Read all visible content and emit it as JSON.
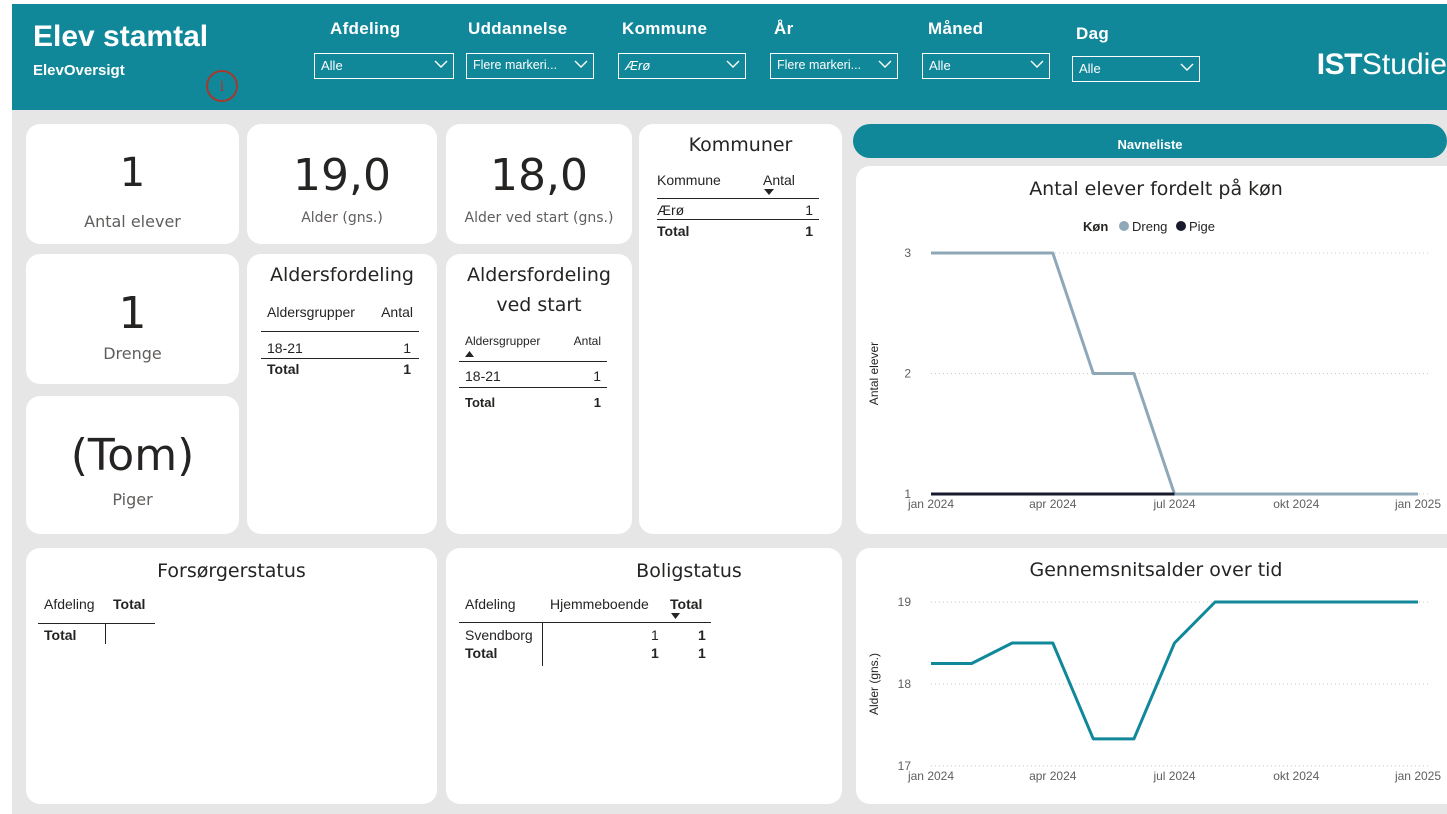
{
  "header": {
    "title": "Elev stamtal",
    "subtitle": "ElevOversigt",
    "logo_bold": "IST",
    "logo_text": "Studie",
    "brand_color": "#118899"
  },
  "slicers": [
    {
      "label": "Afdeling",
      "value": "Alle"
    },
    {
      "label": "Uddannelse",
      "value": "Flere markeri..."
    },
    {
      "label": "Kommune",
      "value": "Ærø"
    },
    {
      "label": "År",
      "value": "Flere markeri..."
    },
    {
      "label": "Måned",
      "value": "Alle"
    },
    {
      "label": "Dag",
      "value": "Alle"
    }
  ],
  "kpis": {
    "antal_elever": {
      "value": "1",
      "label": "Antal elever"
    },
    "alder": {
      "value": "19,0",
      "label": "Alder (gns.)"
    },
    "alder_start": {
      "value": "18,0",
      "label": "Alder ved start (gns.)"
    },
    "drenge": {
      "value": "1",
      "label": "Drenge"
    },
    "piger": {
      "value": "(Tom)",
      "label": "Piger"
    }
  },
  "kommuner": {
    "title": "Kommuner",
    "headers": [
      "Kommune",
      "Antal"
    ],
    "rows": [
      [
        "Ærø",
        "1"
      ]
    ],
    "total": [
      "Total",
      "1"
    ]
  },
  "aldersfordeling": {
    "title": "Aldersfordeling",
    "headers": [
      "Aldersgrupper",
      "Antal"
    ],
    "rows": [
      [
        "18-21",
        "1"
      ]
    ],
    "total": [
      "Total",
      "1"
    ]
  },
  "aldersfordeling_start": {
    "title_line1": "Aldersfordeling",
    "title_line2": "ved start",
    "headers": [
      "Aldersgrupper",
      "Antal"
    ],
    "rows": [
      [
        "18-21",
        "1"
      ]
    ],
    "total": [
      "Total",
      "1"
    ]
  },
  "forsorgerstatus": {
    "title": "Forsørgerstatus",
    "headers": [
      "Afdeling",
      "Total"
    ],
    "total_label": "Total"
  },
  "boligstatus": {
    "title": "Boligstatus",
    "headers": [
      "Afdeling",
      "Hjemmeboende",
      "Total"
    ],
    "rows": [
      [
        "Svendborg",
        "1",
        "1"
      ]
    ],
    "total": [
      "Total",
      "1",
      "1"
    ]
  },
  "navneliste_label": "Navneliste",
  "chart_data": [
    {
      "type": "line",
      "title": "Antal elever fordelt på køn",
      "legend_title": "Køn",
      "legend_position": "top-center",
      "xlabel": "",
      "ylabel": "Antal elever",
      "x_ticks": [
        "jan 2024",
        "apr 2024",
        "jul 2024",
        "okt 2024",
        "jan 2025"
      ],
      "x": [
        "2024-01",
        "2024-02",
        "2024-03",
        "2024-04",
        "2024-05",
        "2024-06",
        "2024-07",
        "2024-08",
        "2024-09",
        "2024-10",
        "2024-11",
        "2024-12",
        "2025-01"
      ],
      "y_ticks": [
        1,
        2,
        3
      ],
      "ylim": [
        1,
        3
      ],
      "grid": true,
      "series": [
        {
          "name": "Dreng",
          "color": "#8fa8b8",
          "values": [
            3,
            3,
            3,
            3,
            2,
            2,
            1,
            1,
            1,
            1,
            1,
            1,
            1
          ]
        },
        {
          "name": "Pige",
          "color": "#1a1a2e",
          "values": [
            1,
            1,
            1,
            1,
            1,
            1,
            1,
            null,
            null,
            null,
            null,
            null,
            null
          ]
        }
      ]
    },
    {
      "type": "line",
      "title": "Gennemsnitsalder over tid",
      "xlabel": "",
      "ylabel": "Alder (gns.)",
      "x_ticks": [
        "jan 2024",
        "apr 2024",
        "jul 2024",
        "okt 2024",
        "jan 2025"
      ],
      "x": [
        "2024-01",
        "2024-02",
        "2024-03",
        "2024-04",
        "2024-05",
        "2024-06",
        "2024-07",
        "2024-08",
        "2024-09",
        "2024-10",
        "2024-11",
        "2024-12",
        "2025-01"
      ],
      "y_ticks": [
        17,
        18,
        19
      ],
      "ylim": [
        17,
        19
      ],
      "grid": true,
      "series": [
        {
          "name": "",
          "color": "#118899",
          "values": [
            18.25,
            18.25,
            18.5,
            18.5,
            17.33,
            17.33,
            18.5,
            19,
            19,
            19,
            19,
            19,
            19
          ]
        }
      ]
    }
  ]
}
